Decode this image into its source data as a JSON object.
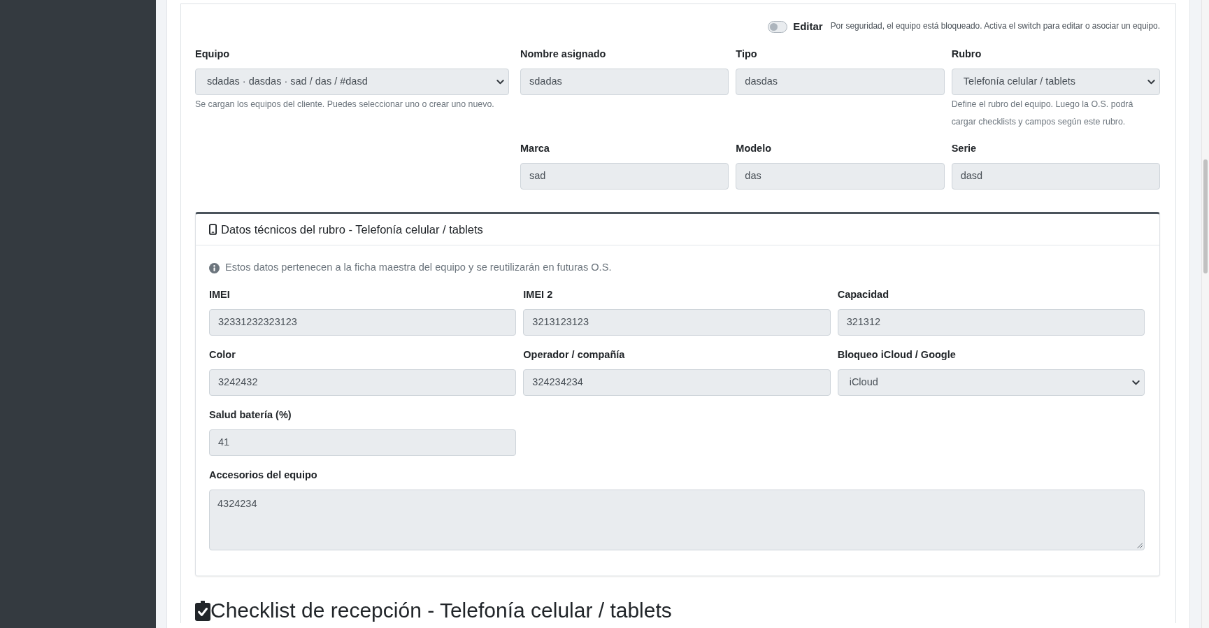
{
  "edit_switch": {
    "on": false,
    "label": "Editar",
    "note": "Por seguridad, el equipo está bloqueado. Activa el switch para editar o asociar un equipo."
  },
  "equipment": {
    "selector": {
      "label": "Equipo",
      "kind": "select",
      "value": "sdadas · dasdas · sad / das / #dasd",
      "disabled": true,
      "help": "Se cargan los equipos del cliente. Puedes seleccionar uno o crear uno nuevo."
    },
    "fields": [
      {
        "label": "Nombre asignado",
        "kind": "text",
        "value": "sdadas",
        "disabled": true
      },
      {
        "label": "Tipo",
        "kind": "text",
        "value": "dasdas",
        "disabled": true
      },
      {
        "label": "Rubro",
        "kind": "select",
        "value": "Telefonía celular / tablets",
        "disabled": true,
        "help": "Define el rubro del equipo. Luego la O.S. podrá cargar checklists y campos según este rubro."
      },
      {
        "label": "Marca",
        "kind": "text",
        "value": "sad",
        "disabled": true
      },
      {
        "label": "Modelo",
        "kind": "text",
        "value": "das",
        "disabled": true
      },
      {
        "label": "Serie",
        "kind": "text",
        "value": "dasd",
        "disabled": true
      }
    ]
  },
  "tech_card": {
    "title": "Datos técnicos del rubro - Telefonía celular / tablets",
    "info": "Estos datos pertenecen a la ficha maestra del equipo y se reutilizarán en futuras O.S.",
    "fields": [
      {
        "label": "IMEI",
        "kind": "text",
        "value": "32331232323123",
        "disabled": true
      },
      {
        "label": "IMEI 2",
        "kind": "text",
        "value": "3213123123",
        "disabled": true
      },
      {
        "label": "Capacidad",
        "kind": "text",
        "value": "321312",
        "disabled": true
      },
      {
        "label": "Color",
        "kind": "text",
        "value": "3242432",
        "disabled": true
      },
      {
        "label": "Operador / compañía",
        "kind": "text",
        "value": "324234234",
        "disabled": true
      },
      {
        "label": "Bloqueo iCloud / Google",
        "kind": "select",
        "value": "iCloud",
        "disabled": true
      },
      {
        "label": "Salud batería (%)",
        "kind": "text",
        "value": "41",
        "disabled": true
      },
      {
        "label": "Accesorios del equipo",
        "kind": "textarea",
        "value": "4324234",
        "disabled": true
      }
    ]
  },
  "checklist": {
    "title": "Checklist de recepción - Telefonía celular / tablets"
  }
}
